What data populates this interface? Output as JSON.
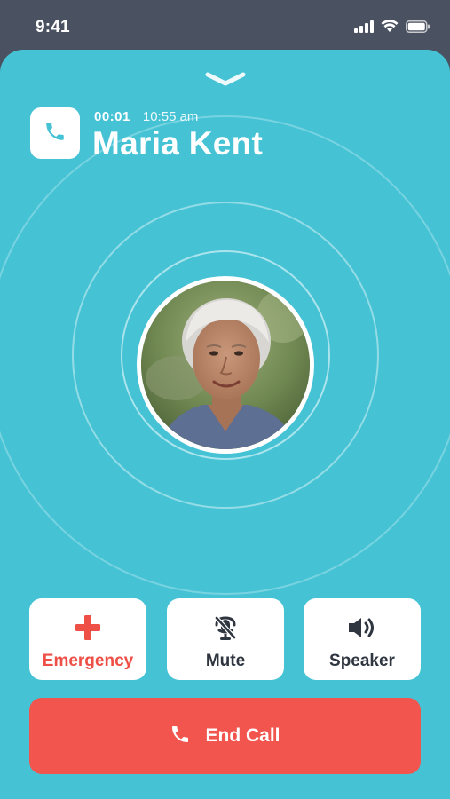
{
  "status_bar": {
    "time": "9:41",
    "icons": [
      "cellular-signal-icon",
      "wifi-icon",
      "battery-icon"
    ]
  },
  "call": {
    "collapse_icon": "chevron-down-icon",
    "type_icon": "phone-icon",
    "duration": "00:01",
    "started_at": "10:55 am",
    "caller_name": "Maria Kent",
    "avatar": "caller-photo"
  },
  "actions": {
    "emergency_label": "Emergency",
    "emergency_icon": "medical-cross-icon",
    "mute_label": "Mute",
    "mute_icon": "microphone-mute-icon",
    "speaker_label": "Speaker",
    "speaker_icon": "speaker-icon",
    "end_call_label": "End Call",
    "end_call_icon": "phone-hangup-icon"
  },
  "colors": {
    "background": "#45c3d5",
    "accent_red": "#f2554d",
    "emergency_text": "#ee4f46",
    "button_bg": "#ffffff",
    "button_text": "#2f3640"
  }
}
